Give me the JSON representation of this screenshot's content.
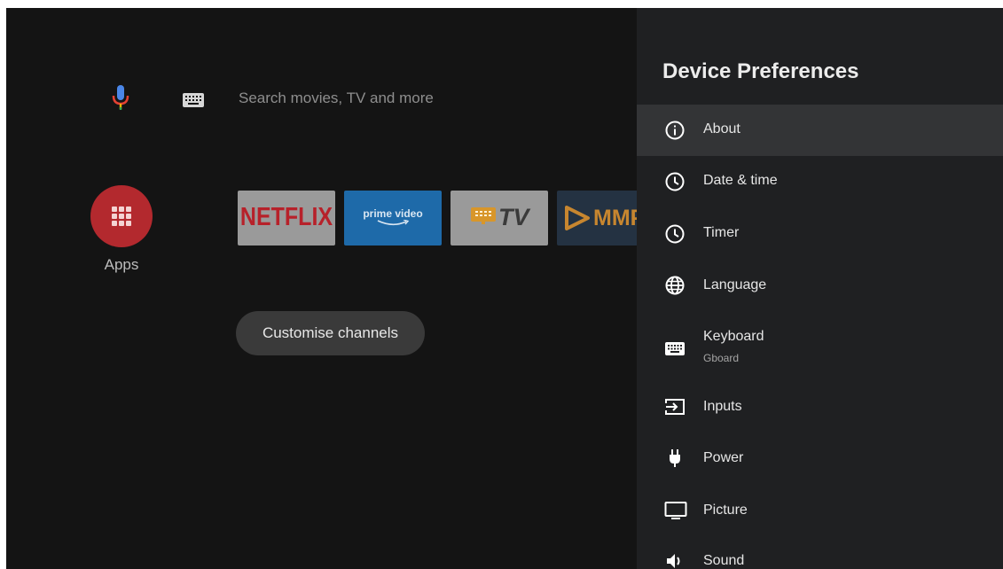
{
  "search": {
    "placeholder": "Search movies, TV and more"
  },
  "apps": {
    "label": "Apps"
  },
  "tiles": [
    {
      "name": "NETFLIX"
    },
    {
      "name": "prime video"
    },
    {
      "name": "TV"
    },
    {
      "name": "MMP"
    }
  ],
  "customise": {
    "label": "Customise channels"
  },
  "panel": {
    "title": "Device Preferences",
    "items": [
      {
        "title": "About",
        "icon": "info-icon"
      },
      {
        "title": "Date & time",
        "icon": "clock-icon"
      },
      {
        "title": "Timer",
        "icon": "clock-icon"
      },
      {
        "title": "Language",
        "icon": "globe-icon"
      },
      {
        "title": "Keyboard",
        "subtitle": "Gboard",
        "icon": "keyboard-icon"
      },
      {
        "title": "Inputs",
        "icon": "input-icon"
      },
      {
        "title": "Power",
        "icon": "plug-icon"
      },
      {
        "title": "Picture",
        "icon": "monitor-icon"
      },
      {
        "title": "Sound",
        "icon": "speaker-icon"
      }
    ]
  },
  "colors": {
    "background": "#141414",
    "panel": "#1f2022",
    "selected_row": "#333436",
    "apps_button": "#b3292e",
    "netflix_red": "#b7212a",
    "prime_blue": "#1e6aa9",
    "mmp_orange": "#c7862f"
  }
}
